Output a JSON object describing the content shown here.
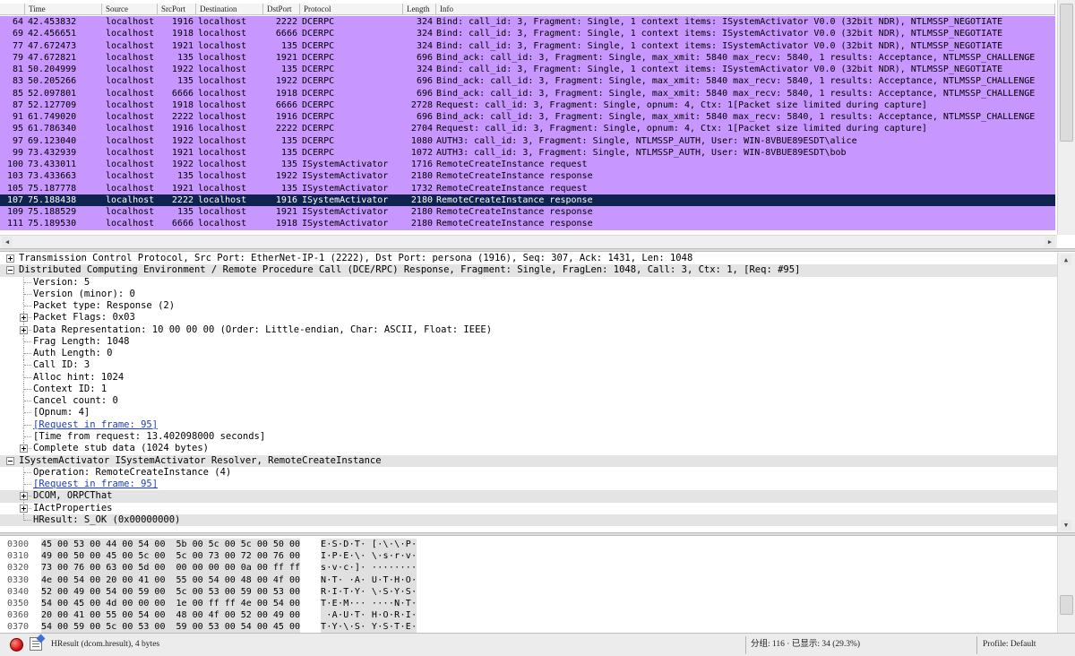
{
  "packet_list": {
    "columns": [
      "Time",
      "Source",
      "SrcPort",
      "Destination",
      "DstPort",
      "Protocol",
      "Length",
      "Info"
    ],
    "rows": [
      {
        "no": "64",
        "time": "42.453832",
        "src": "localhost",
        "sport": "1916",
        "dst": "localhost",
        "dport": "2222",
        "proto": "DCERPC",
        "len": "324",
        "info": "Bind: call_id: 3, Fragment: Single, 1 context items: ISystemActivator V0.0 (32bit NDR), NTLMSSP_NEGOTIATE"
      },
      {
        "no": "69",
        "time": "42.456651",
        "src": "localhost",
        "sport": "1918",
        "dst": "localhost",
        "dport": "6666",
        "proto": "DCERPC",
        "len": "324",
        "info": "Bind: call_id: 3, Fragment: Single, 1 context items: ISystemActivator V0.0 (32bit NDR), NTLMSSP_NEGOTIATE"
      },
      {
        "no": "77",
        "time": "47.672473",
        "src": "localhost",
        "sport": "1921",
        "dst": "localhost",
        "dport": "135",
        "proto": "DCERPC",
        "len": "324",
        "info": "Bind: call_id: 3, Fragment: Single, 1 context items: ISystemActivator V0.0 (32bit NDR), NTLMSSP_NEGOTIATE"
      },
      {
        "no": "79",
        "time": "47.672821",
        "src": "localhost",
        "sport": "135",
        "dst": "localhost",
        "dport": "1921",
        "proto": "DCERPC",
        "len": "696",
        "info": "Bind_ack: call_id: 3, Fragment: Single, max_xmit: 5840 max_recv: 5840, 1 results: Acceptance, NTLMSSP_CHALLENGE"
      },
      {
        "no": "81",
        "time": "50.204999",
        "src": "localhost",
        "sport": "1922",
        "dst": "localhost",
        "dport": "135",
        "proto": "DCERPC",
        "len": "324",
        "info": "Bind: call_id: 3, Fragment: Single, 1 context items: ISystemActivator V0.0 (32bit NDR), NTLMSSP_NEGOTIATE"
      },
      {
        "no": "83",
        "time": "50.205266",
        "src": "localhost",
        "sport": "135",
        "dst": "localhost",
        "dport": "1922",
        "proto": "DCERPC",
        "len": "696",
        "info": "Bind_ack: call_id: 3, Fragment: Single, max_xmit: 5840 max_recv: 5840, 1 results: Acceptance, NTLMSSP_CHALLENGE"
      },
      {
        "no": "85",
        "time": "52.097801",
        "src": "localhost",
        "sport": "6666",
        "dst": "localhost",
        "dport": "1918",
        "proto": "DCERPC",
        "len": "696",
        "info": "Bind_ack: call_id: 3, Fragment: Single, max_xmit: 5840 max_recv: 5840, 1 results: Acceptance, NTLMSSP_CHALLENGE"
      },
      {
        "no": "87",
        "time": "52.127709",
        "src": "localhost",
        "sport": "1918",
        "dst": "localhost",
        "dport": "6666",
        "proto": "DCERPC",
        "len": "2728",
        "info": "Request: call_id: 3, Fragment: Single, opnum: 4, Ctx: 1[Packet size limited during capture]"
      },
      {
        "no": "91",
        "time": "61.749020",
        "src": "localhost",
        "sport": "2222",
        "dst": "localhost",
        "dport": "1916",
        "proto": "DCERPC",
        "len": "696",
        "info": "Bind_ack: call_id: 3, Fragment: Single, max_xmit: 5840 max_recv: 5840, 1 results: Acceptance, NTLMSSP_CHALLENGE"
      },
      {
        "no": "95",
        "time": "61.786340",
        "src": "localhost",
        "sport": "1916",
        "dst": "localhost",
        "dport": "2222",
        "proto": "DCERPC",
        "len": "2704",
        "info": "Request: call_id: 3, Fragment: Single, opnum: 4, Ctx: 1[Packet size limited during capture]"
      },
      {
        "no": "97",
        "time": "69.123040",
        "src": "localhost",
        "sport": "1922",
        "dst": "localhost",
        "dport": "135",
        "proto": "DCERPC",
        "len": "1080",
        "info": "AUTH3: call_id: 3, Fragment: Single, NTLMSSP_AUTH, User: WIN-8VBUE89ESDT\\alice"
      },
      {
        "no": "99",
        "time": "73.432939",
        "src": "localhost",
        "sport": "1921",
        "dst": "localhost",
        "dport": "135",
        "proto": "DCERPC",
        "len": "1072",
        "info": "AUTH3: call_id: 3, Fragment: Single, NTLMSSP_AUTH, User: WIN-8VBUE89ESDT\\bob"
      },
      {
        "no": "100",
        "time": "73.433011",
        "src": "localhost",
        "sport": "1922",
        "dst": "localhost",
        "dport": "135",
        "proto": "ISystemActivator",
        "len": "1716",
        "info": "RemoteCreateInstance request"
      },
      {
        "no": "103",
        "time": "73.433663",
        "src": "localhost",
        "sport": "135",
        "dst": "localhost",
        "dport": "1922",
        "proto": "ISystemActivator",
        "len": "2180",
        "info": "RemoteCreateInstance response"
      },
      {
        "no": "105",
        "time": "75.187778",
        "src": "localhost",
        "sport": "1921",
        "dst": "localhost",
        "dport": "135",
        "proto": "ISystemActivator",
        "len": "1732",
        "info": "RemoteCreateInstance request"
      },
      {
        "no": "107",
        "time": "75.188438",
        "src": "localhost",
        "sport": "2222",
        "dst": "localhost",
        "dport": "1916",
        "proto": "ISystemActivator",
        "len": "2180",
        "info": "RemoteCreateInstance response",
        "selected": true
      },
      {
        "no": "109",
        "time": "75.188529",
        "src": "localhost",
        "sport": "135",
        "dst": "localhost",
        "dport": "1921",
        "proto": "ISystemActivator",
        "len": "2180",
        "info": "RemoteCreateInstance response"
      },
      {
        "no": "111",
        "time": "75.189530",
        "src": "localhost",
        "sport": "6666",
        "dst": "localhost",
        "dport": "1918",
        "proto": "ISystemActivator",
        "len": "2180",
        "info": "RemoteCreateInstance response"
      }
    ]
  },
  "detail_tree": [
    {
      "level": 0,
      "expander": "plus",
      "text": "Transmission Control Protocol, Src Port: EtherNet-IP-1 (2222), Dst Port: persona (1916), Seq: 307, Ack: 1431, Len: 1048"
    },
    {
      "level": 0,
      "expander": "minus",
      "text": "Distributed Computing Environment / Remote Procedure Call (DCE/RPC) Response, Fragment: Single, FragLen: 1048, Call: 3, Ctx: 1, [Req: #95]",
      "highlight": true
    },
    {
      "level": 1,
      "text": "Version: 5"
    },
    {
      "level": 1,
      "text": "Version (minor): 0"
    },
    {
      "level": 1,
      "text": "Packet type: Response (2)"
    },
    {
      "level": 1,
      "expander": "plus",
      "text": "Packet Flags: 0x03"
    },
    {
      "level": 1,
      "expander": "plus",
      "text": "Data Representation: 10 00 00 00 (Order: Little-endian, Char: ASCII, Float: IEEE)"
    },
    {
      "level": 1,
      "text": "Frag Length: 1048"
    },
    {
      "level": 1,
      "text": "Auth Length: 0"
    },
    {
      "level": 1,
      "text": "Call ID: 3"
    },
    {
      "level": 1,
      "text": "Alloc hint: 1024"
    },
    {
      "level": 1,
      "text": "Context ID: 1"
    },
    {
      "level": 1,
      "text": "Cancel count: 0"
    },
    {
      "level": 1,
      "text": "[Opnum: 4]"
    },
    {
      "level": 1,
      "text": "[Request in frame: 95]",
      "link": true
    },
    {
      "level": 1,
      "text": "[Time from request: 13.402098000 seconds]"
    },
    {
      "level": 1,
      "expander": "plus",
      "text": "Complete stub data (1024 bytes)"
    },
    {
      "level": 0,
      "expander": "minus",
      "text": "ISystemActivator ISystemActivator Resolver, RemoteCreateInstance",
      "highlight": true
    },
    {
      "level": 1,
      "text": "Operation: RemoteCreateInstance (4)"
    },
    {
      "level": 1,
      "text": "[Request in frame: 95]",
      "link": true
    },
    {
      "level": 1,
      "expander": "plus",
      "text": "DCOM, ORPCThat",
      "highlight": true
    },
    {
      "level": 1,
      "expander": "plus",
      "text": "IActProperties"
    },
    {
      "level": 1,
      "text": "HResult: S_OK (0x00000000)",
      "highlight": true
    }
  ],
  "hex_dump": [
    {
      "offset": "0300",
      "bytes": "45 00 53 00 44 00 54 00  5b 00 5c 00 5c 00 50 00",
      "ascii": "E·S·D·T· [·\\·\\·P·"
    },
    {
      "offset": "0310",
      "bytes": "49 00 50 00 45 00 5c 00  5c 00 73 00 72 00 76 00",
      "ascii": "I·P·E·\\· \\·s·r·v·"
    },
    {
      "offset": "0320",
      "bytes": "73 00 76 00 63 00 5d 00  00 00 00 00 0a 00 ff ff",
      "ascii": "s·v·c·]· ········"
    },
    {
      "offset": "0330",
      "bytes": "4e 00 54 00 20 00 41 00  55 00 54 00 48 00 4f 00",
      "ascii": "N·T· ·A· U·T·H·O·"
    },
    {
      "offset": "0340",
      "bytes": "52 00 49 00 54 00 59 00  5c 00 53 00 59 00 53 00",
      "ascii": "R·I·T·Y· \\·S·Y·S·"
    },
    {
      "offset": "0350",
      "bytes": "54 00 45 00 4d 00 00 00  1e 00 ff ff 4e 00 54 00",
      "ascii": "T·E·M··· ····N·T·"
    },
    {
      "offset": "0360",
      "bytes": "20 00 41 00 55 00 54 00  48 00 4f 00 52 00 49 00",
      "ascii": " ·A·U·T· H·O·R·I·"
    },
    {
      "offset": "0370",
      "bytes": "54 00 59 00 5c 00 53 00  59 00 53 00 54 00 45 00",
      "ascii": "T·Y·\\·S· Y·S·T·E·"
    }
  ],
  "status_bar": {
    "field_info": "HResult (dcom.hresult), 4 bytes",
    "packet_counts": "分组: 116 · 已显示: 34 (29.3%)",
    "profile": "Profile: Default",
    "capture_icon": "red-stop-icon",
    "note_icon": "expert-info-icon"
  },
  "colors": {
    "row_dcerpc": "#c797ff",
    "row_selected": "#10234f",
    "link": "#1a3cc8"
  }
}
